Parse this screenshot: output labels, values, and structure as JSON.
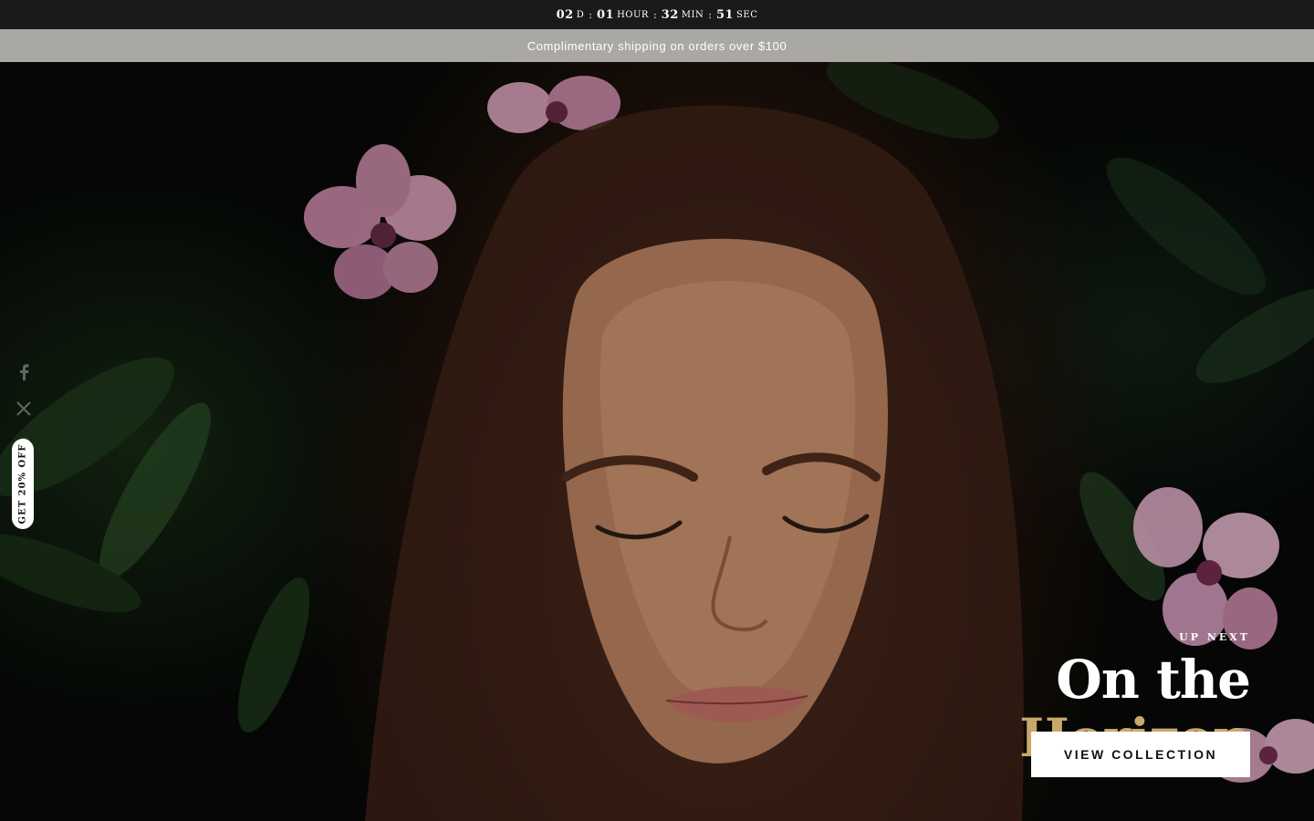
{
  "countdown": {
    "days": "02",
    "days_unit": "D",
    "hours": "01",
    "hours_unit": "HOUR",
    "minutes": "32",
    "minutes_unit": "MIN",
    "seconds": "51",
    "seconds_unit": "SEC",
    "separator": ":"
  },
  "announcement": {
    "text": "Complimentary shipping on orders over $100"
  },
  "social": {
    "icons": [
      "facebook-icon",
      "x-icon",
      "pinterest-icon",
      "instagram-icon"
    ]
  },
  "promo": {
    "label": "GET 20% OFF"
  },
  "hero": {
    "eyebrow": "UP NEXT",
    "title_line1": "On the",
    "title_line2": "Horizon",
    "cta_label": "VIEW COLLECTION"
  },
  "colors": {
    "countdown_bg": "#1a1a1a",
    "announcement_bg": "#a9a8a3",
    "accent_gold": "#c9a96b",
    "cta_bg": "#ffffff"
  }
}
